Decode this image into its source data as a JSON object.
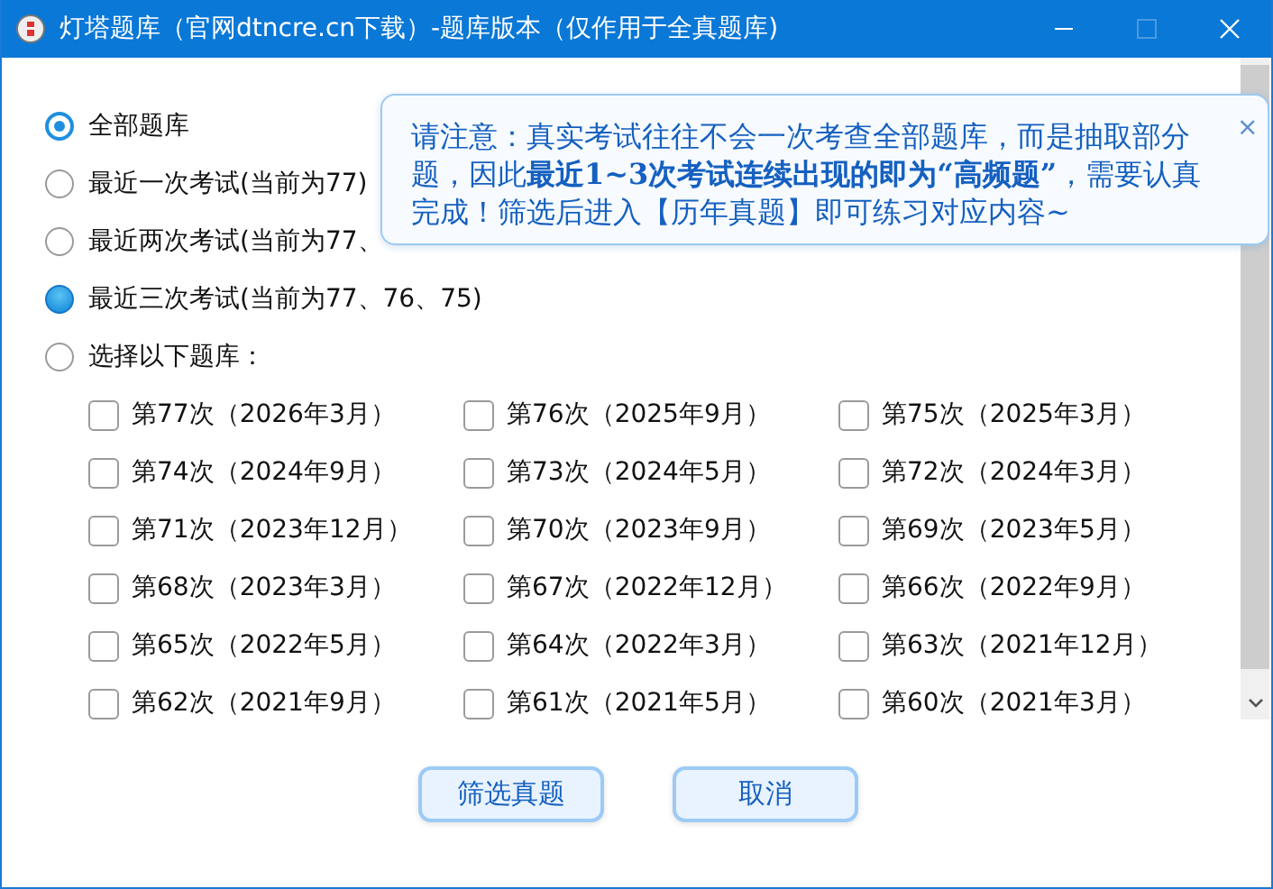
{
  "window": {
    "title": "灯塔题库（官网dtncre.cn下载）-题库版本（仅作用于全真题库)",
    "maximize_disabled": true
  },
  "options": [
    {
      "label": "全部题库",
      "selected": true,
      "hovered": false
    },
    {
      "label": "最近一次考试(当前为77)",
      "selected": false,
      "hovered": false
    },
    {
      "label": "最近两次考试(当前为77、",
      "selected": false,
      "hovered": false
    },
    {
      "label": "最近三次考试(当前为77、76、75)",
      "selected": false,
      "hovered": true
    },
    {
      "label": "选择以下题库：",
      "selected": false,
      "hovered": false
    }
  ],
  "banks": [
    {
      "label": "第77次（2026年3月）",
      "checked": false
    },
    {
      "label": "第76次（2025年9月）",
      "checked": false
    },
    {
      "label": "第75次（2025年3月）",
      "checked": false
    },
    {
      "label": "第74次（2024年9月）",
      "checked": false
    },
    {
      "label": "第73次（2024年5月）",
      "checked": false
    },
    {
      "label": "第72次（2024年3月）",
      "checked": false
    },
    {
      "label": "第71次（2023年12月）",
      "checked": false
    },
    {
      "label": "第70次（2023年9月）",
      "checked": false
    },
    {
      "label": "第69次（2023年5月）",
      "checked": false
    },
    {
      "label": "第68次（2023年3月）",
      "checked": false
    },
    {
      "label": "第67次（2022年12月）",
      "checked": false
    },
    {
      "label": "第66次（2022年9月）",
      "checked": false
    },
    {
      "label": "第65次（2022年5月）",
      "checked": false
    },
    {
      "label": "第64次（2022年3月）",
      "checked": false
    },
    {
      "label": "第63次（2021年12月）",
      "checked": false
    },
    {
      "label": "第62次（2021年9月）",
      "checked": false
    },
    {
      "label": "第61次（2021年5月）",
      "checked": false
    },
    {
      "label": "第60次（2021年3月）",
      "checked": false
    }
  ],
  "notice": {
    "text": "请注意：真实考试往往不会一次考查全部题库，而是抽取部分题，因此**最近1~3次考试连续出现的即为“高频题”**，需要认真完成！筛选后进入【历年真题】即可练习对应内容~",
    "close": "×"
  },
  "buttons": [
    {
      "label": "筛选真题"
    },
    {
      "label": "取消"
    }
  ]
}
